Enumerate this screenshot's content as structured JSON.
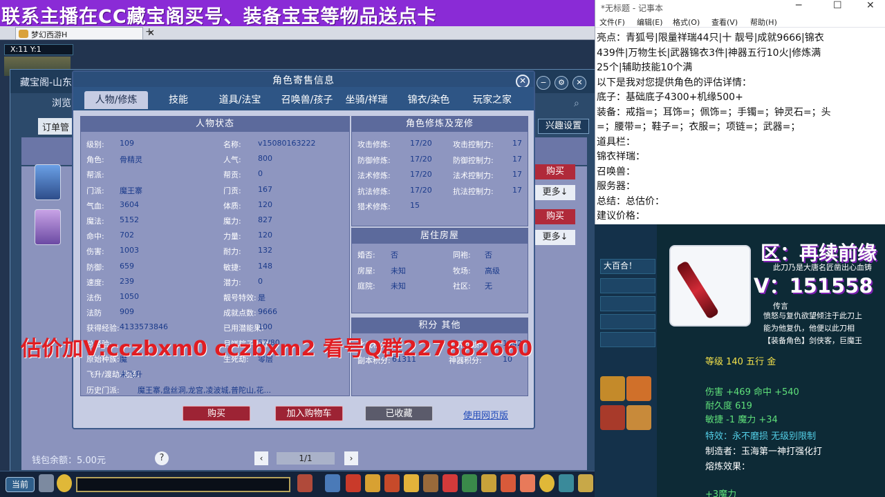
{
  "banner": {
    "text": "联系主播在CC藏宝阁买号、装备宝宝等物品送点卡"
  },
  "game": {
    "tab_title": "梦幻西游H",
    "hud_coords": "X:11 Y:1",
    "bg_title": "藏宝阁-山东",
    "bg_subtitle": "浏览",
    "bg_order": "订单管",
    "fav_setting": "兴趣设置",
    "buy_1": "购买",
    "more_1": "更多↓",
    "buy_2": "购买",
    "more_2": "更多↓",
    "wallet": "钱包余额：5.00元",
    "help": "?",
    "pager": "1/1",
    "current_btn": "当前"
  },
  "modal": {
    "title": "角色寄售信息",
    "tabs": [
      "人物/修炼",
      "技能",
      "道具/法宝",
      "召唤兽/孩子",
      "坐骑/祥瑞",
      "锦衣/染色",
      "玩家之家"
    ],
    "status_head": "人物状态",
    "status": [
      {
        "label": "级别:",
        "value": "109"
      },
      {
        "label": "名称:",
        "value": "v15080163222"
      },
      {
        "label": "角色:",
        "value": "骨精灵"
      },
      {
        "label": "人气:",
        "value": "800"
      },
      {
        "label": "帮派:",
        "value": ""
      },
      {
        "label": "帮贡:",
        "value": "0"
      },
      {
        "label": "门派:",
        "value": "魔王寨"
      },
      {
        "label": "门贡:",
        "value": "167"
      },
      {
        "label": "气血:",
        "value": "3604"
      },
      {
        "label": "体质:",
        "value": "120"
      },
      {
        "label": "魔法:",
        "value": "5152"
      },
      {
        "label": "魔力:",
        "value": "827"
      },
      {
        "label": "命中:",
        "value": "702"
      },
      {
        "label": "力量:",
        "value": "120"
      },
      {
        "label": "伤害:",
        "value": "1003"
      },
      {
        "label": "耐力:",
        "value": "132"
      },
      {
        "label": "防御:",
        "value": "659"
      },
      {
        "label": "敏捷:",
        "value": "148"
      },
      {
        "label": "速度:",
        "value": "239"
      },
      {
        "label": "潜力:",
        "value": "0"
      },
      {
        "label": "法伤",
        "value": "1050"
      },
      {
        "label": "靓号特效:",
        "value": "是"
      },
      {
        "label": "法防",
        "value": "909"
      },
      {
        "label": "成就点数:",
        "value": "9666"
      },
      {
        "label": "获得经验:",
        "value": "4133573846"
      },
      {
        "label": "已用潜能果:",
        "value": "100"
      },
      {
        "label": "总经验:",
        "value": ""
      },
      {
        "label": "月饼粽子机缘:",
        "value": "57/80"
      },
      {
        "label": "原始种族:",
        "value": "魔"
      },
      {
        "label": "生死劫:",
        "value": "零层"
      },
      {
        "label": "飞升/渡劫/化圣:",
        "value": "未飞升"
      }
    ],
    "history_label": "历史门派:",
    "history_value": "魔王寨,盘丝洞,龙宫,凌波城,普陀山,花...",
    "cultivation_head": "角色修炼及宠修",
    "cultivation": [
      {
        "label": "攻击修炼:",
        "value": "17/20"
      },
      {
        "label": "攻击控制力:",
        "value": "17"
      },
      {
        "label": "防御修炼:",
        "value": "17/20"
      },
      {
        "label": "防御控制力:",
        "value": "17"
      },
      {
        "label": "法术修炼:",
        "value": "17/20"
      },
      {
        "label": "法术控制力:",
        "value": "17"
      },
      {
        "label": "抗法修炼:",
        "value": "17/20"
      },
      {
        "label": "抗法控制力:",
        "value": "17"
      },
      {
        "label": "猎术修炼:",
        "value": "15"
      }
    ],
    "house_head": "居住房屋",
    "house": [
      {
        "label": "婚否:",
        "value": "否"
      },
      {
        "label": "同袍:",
        "value": "否"
      },
      {
        "label": "房屋:",
        "value": "未知"
      },
      {
        "label": "牧场:",
        "value": "高级"
      },
      {
        "label": "庭院:",
        "value": "未知"
      },
      {
        "label": "社区:",
        "value": "无"
      }
    ],
    "points_head": "积分 其他",
    "points": [
      {
        "label": "比武积分:",
        "value": ""
      },
      {
        "label": "三界功绩:",
        "value": "1042"
      },
      {
        "label": "副本积分:",
        "value": "61311"
      },
      {
        "label": "神器积分:",
        "value": "10"
      }
    ],
    "btn_buy": "购买",
    "btn_cart": "加入购物车",
    "btn_fav": "已收藏",
    "web_link": "使用网页版"
  },
  "overlay": {
    "text": "估价加V:cczbxm0    cczbxm2    看号Q群227882660"
  },
  "notepad": {
    "title": "*无标题 - 记事本",
    "menu": [
      "文件(F)",
      "编辑(E)",
      "格式(O)",
      "查看(V)",
      "帮助(H)"
    ],
    "lines": [
      "亮点：青狐号|限量祥瑞44只|十 靓号|成就9666|锦衣",
      "439件|万物生长|武器锦衣3件|神器五行10火|修炼满",
      "25个|辅助技能10个满",
      "以下是我对您提供角色的评估详情：",
      "底子：基础底子4300+机缘500+",
      "装备：戒指=；耳饰=；佩饰=；手镯=；钟灵石=；头",
      "=；腰带=；鞋子=；衣服=；项链=；武器=；",
      "道具栏：",
      "锦衣祥瑞：",
      "召唤兽：",
      "服务器：",
      "总结：总估价：",
      "建议价格："
    ]
  },
  "item_panel": {
    "region_text": "区：再续前缘",
    "v_text": "V：151558",
    "stream_msg": "大百合！",
    "desc": [
      "此刀乃是大唐名匠凿出心血铸",
      "传言",
      "愤怒与复仇欲望倾注于此刀上",
      "能为他复仇，他便以此刀相",
      "【装备角色】剑侠客，巨魔王"
    ],
    "level_line": "等级 140 五行 金",
    "damage_line": "伤害 +469 命中 +540",
    "durability_line": "耐久度 619",
    "agility_line": "敏捷 -1 魔力 +34",
    "special_line": "特效：永不磨损 无级别限制",
    "maker_line": "制造者：玉海第一神打强化打",
    "refine_line": "熔炼效果：",
    "bottom_line": "+3魔力"
  }
}
